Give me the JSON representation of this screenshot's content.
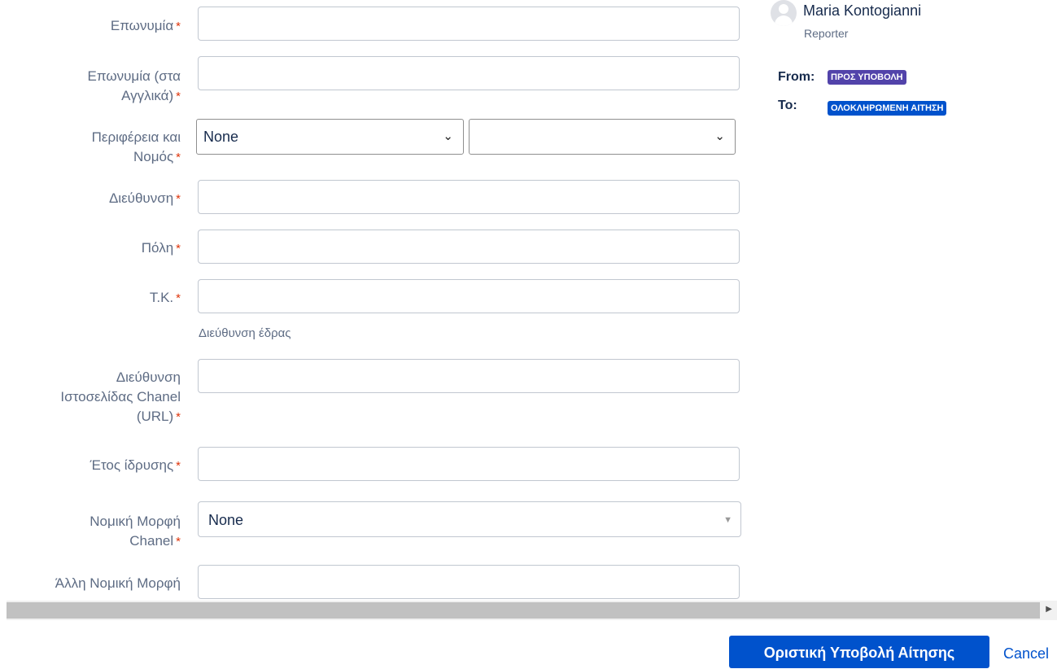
{
  "form": {
    "fields": [
      {
        "label": "Επωνυμία",
        "required": "*"
      },
      {
        "label_line1": "Επωνυμία (στα",
        "label_line2": "Αγγλικά)",
        "required": "*"
      },
      {
        "label_line1": "Περιφέρεια και",
        "label_line2": "Νομός",
        "required": "*"
      },
      {
        "label": "Διεύθυνση",
        "required": "*"
      },
      {
        "label": "Πόλη",
        "required": "*"
      },
      {
        "label": "Τ.Κ.",
        "required": "*"
      },
      {
        "label_line1": "Διεύθυνση",
        "label_line2": "Ιστοσελίδας Chanel",
        "label_line3": "(URL)",
        "required": "*"
      },
      {
        "label": "Έτος ίδρυσης",
        "required": "*"
      },
      {
        "label_line1": "Νομική Μορφή",
        "label_line2": "Chanel",
        "required": "*"
      },
      {
        "label": "Άλλη Νομική Μορφή"
      }
    ],
    "region_select_value": "None",
    "prefecture_select_value": "",
    "address_help": "Διεύθυνση έδρας",
    "legal_form_value": "None"
  },
  "sidebar": {
    "user_name": "Maria Kontogianni",
    "user_role": "Reporter",
    "from_label": "From:",
    "from_status": "ΠΡΟΣ ΥΠΟΒΟΛΗ",
    "to_label": "To:",
    "to_status": "ΟΛΟΚΛΗΡΩΜΕΝΗ ΑΙΤΗΣΗ",
    "colors": {
      "from_status": "#5243aa",
      "to_status": "#0052cc"
    }
  },
  "footer": {
    "submit_label": "Οριστική Υποβολή Αίτησης",
    "cancel_label": "Cancel"
  }
}
